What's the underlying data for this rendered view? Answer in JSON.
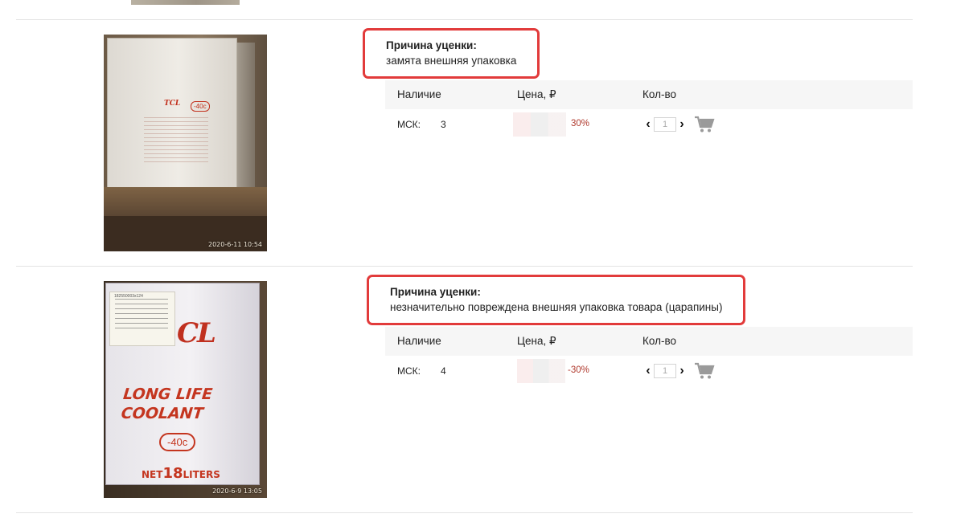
{
  "products": [
    {
      "reason": {
        "title": "Причина уценки:",
        "text": "замята внешняя упаковка"
      },
      "photo_stamp": "2020-6-11 10:54",
      "photo_text": {
        "brand": "TCL",
        "temp": "-40c"
      },
      "table_headers": {
        "availability": "Наличие",
        "price": "Цена, ₽",
        "quantity": "Кол-во"
      },
      "warehouse": "МСК:",
      "stock": "3",
      "discount": "30%",
      "qty_value": "1",
      "icons": {
        "prev": "chevron-left-icon",
        "next": "chevron-right-icon",
        "cart": "cart-icon"
      }
    },
    {
      "reason": {
        "title": "Причина уценки:",
        "text": "незначительно повреждена внешняя упаковка товара (царапины)"
      },
      "photo_stamp": "2020-6-9 13:05",
      "photo_text": {
        "label_code": "182550003x124",
        "brand": "CL",
        "line1": "LONG LIFE",
        "line2": "COOLANT",
        "temp": "-40c",
        "net": "NET",
        "liters_num": "18",
        "liters": "LITERS"
      },
      "table_headers": {
        "availability": "Наличие",
        "price": "Цена, ₽",
        "quantity": "Кол-во"
      },
      "warehouse": "МСК:",
      "stock": "4",
      "discount": "-30%",
      "qty_value": "1",
      "icons": {
        "prev": "chevron-left-icon",
        "next": "chevron-right-icon",
        "cart": "cart-icon"
      }
    }
  ],
  "colors": {
    "reason_border": "#e23b3b",
    "discount": "#b03a2e",
    "header_bg": "#f6f6f6"
  }
}
